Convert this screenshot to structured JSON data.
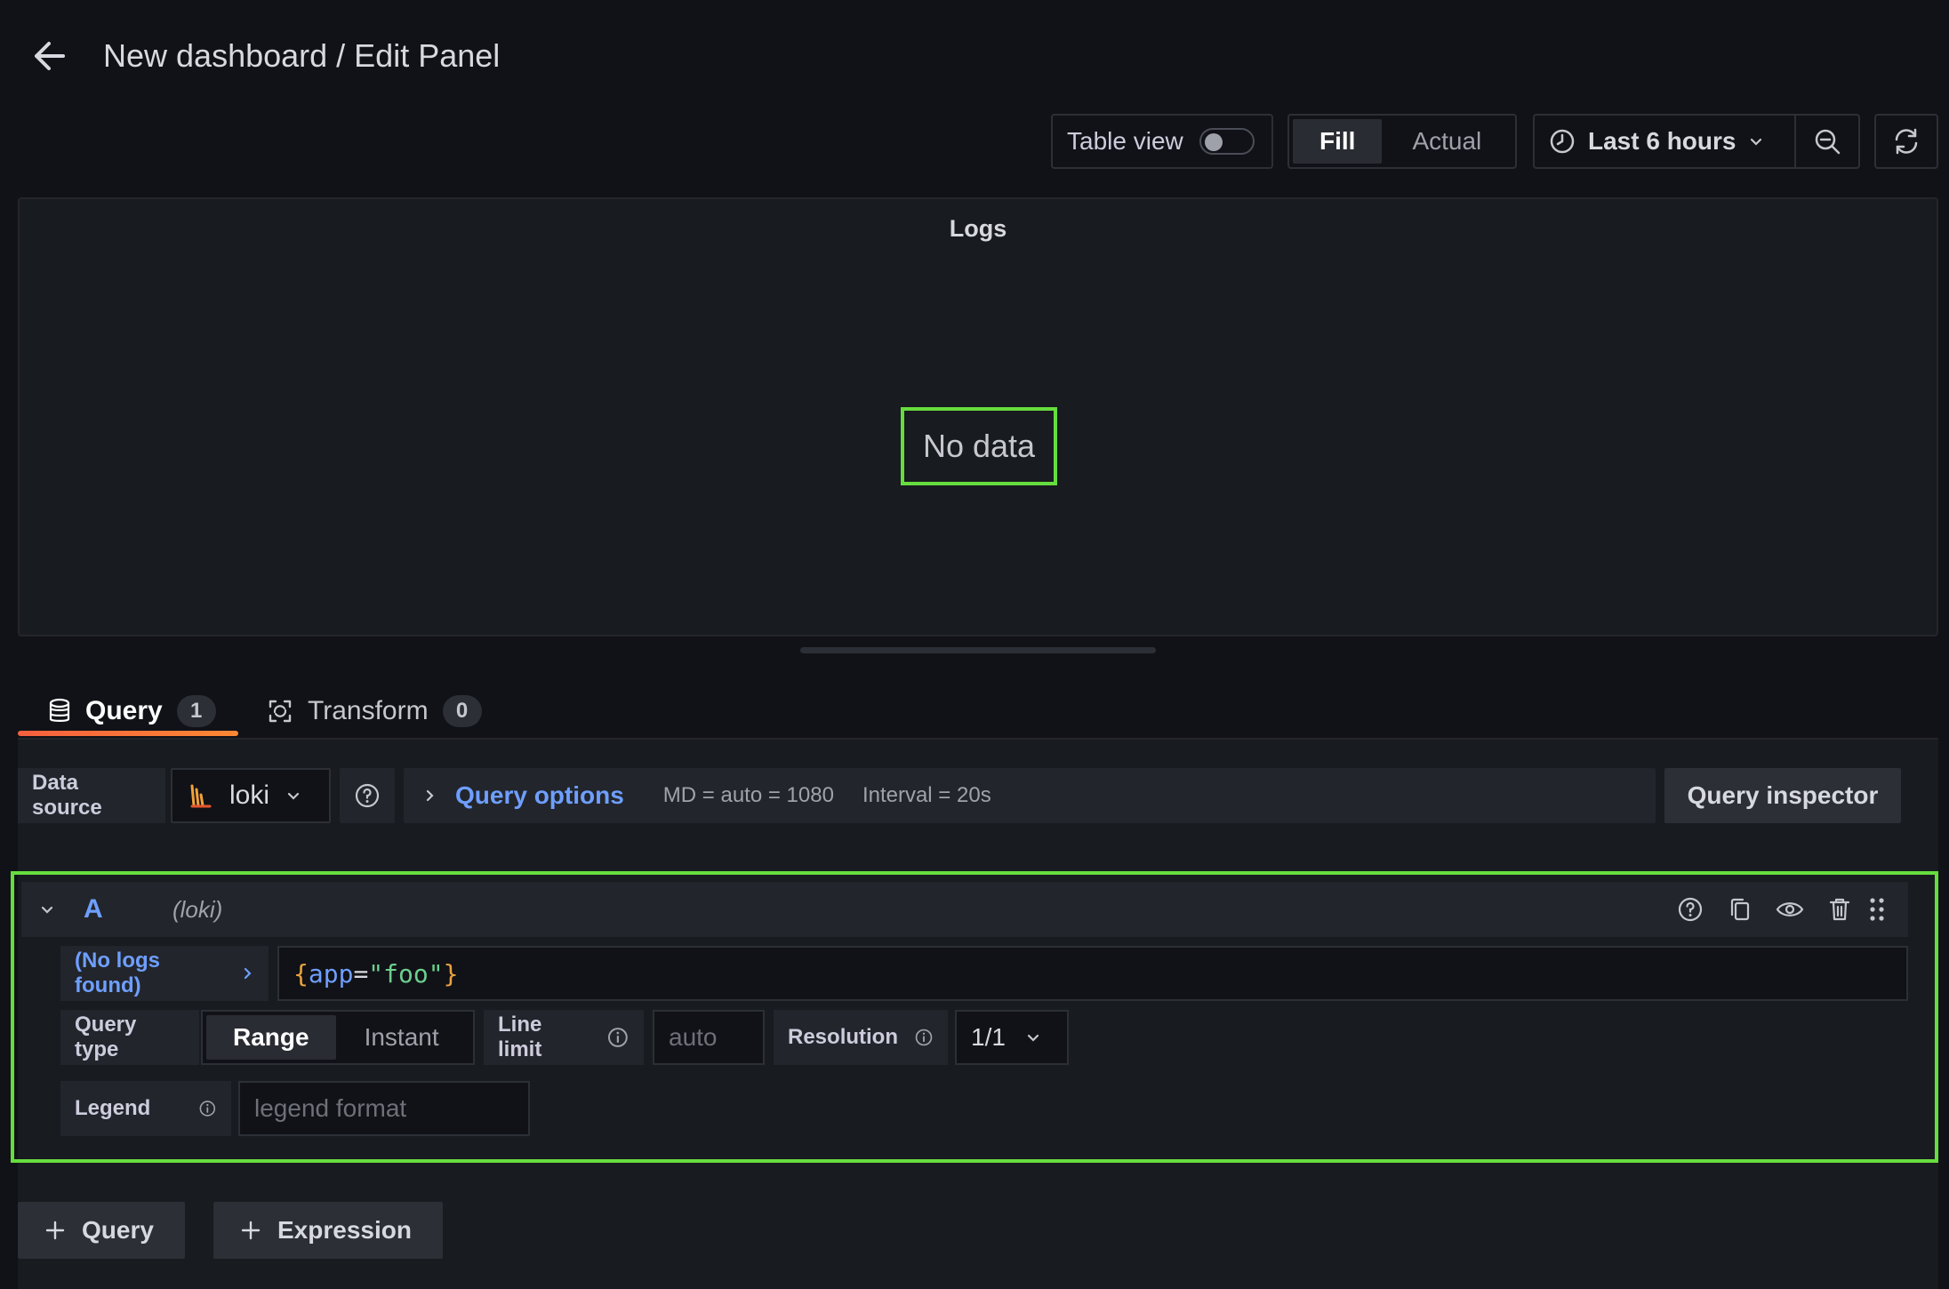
{
  "header": {
    "title": "New dashboard / Edit Panel"
  },
  "toolbar": {
    "table_view_label": "Table view",
    "fill_label": "Fill",
    "actual_label": "Actual",
    "time_range": "Last 6 hours"
  },
  "panel": {
    "title": "Logs",
    "empty_message": "No data"
  },
  "tabs": {
    "query": {
      "label": "Query",
      "count": "1"
    },
    "transform": {
      "label": "Transform",
      "count": "0"
    }
  },
  "datasource": {
    "label": "Data source",
    "selected": "loki",
    "query_options_label": "Query options",
    "md": "MD = auto = 1080",
    "interval": "Interval = 20s",
    "inspector_label": "Query inspector"
  },
  "query_a": {
    "ref_id": "A",
    "datasource": "(loki)",
    "log_browser_label": "(No logs found)",
    "expr": {
      "open": "{",
      "key": "app",
      "op": "=",
      "value": "\"foo\"",
      "close": "}"
    },
    "query_type_label": "Query type",
    "query_type_options": [
      "Range",
      "Instant"
    ],
    "line_limit_label": "Line limit",
    "line_limit_placeholder": "auto",
    "resolution_label": "Resolution",
    "resolution_value": "1/1",
    "legend_label": "Legend",
    "legend_placeholder": "legend format"
  },
  "actions": {
    "add_query": "Query",
    "add_expression": "Expression"
  },
  "colors": {
    "background": "#111217",
    "panel": "#181b1f",
    "accent_blue": "#6e9fff",
    "highlight_green": "#66dd3e",
    "tab_underline": "#ff8833"
  }
}
